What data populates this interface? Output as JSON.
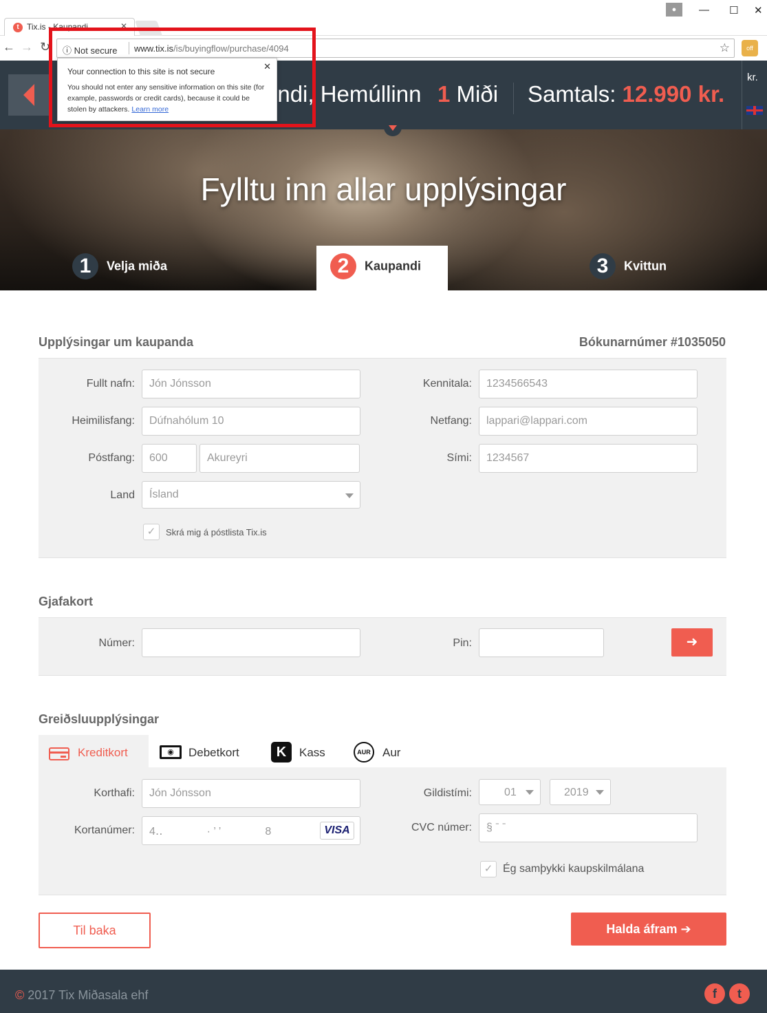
{
  "browser": {
    "tab_title": "Tix.is - Kaupandi",
    "favicon_letter": "t",
    "security_label": "Not secure",
    "url_host": "www.tix.is",
    "url_path": "/is/buyingflow/purchase/4094",
    "profile_icon": "person-icon",
    "extension_badge": "off"
  },
  "security_popup": {
    "title": "Your connection to this site is not secure",
    "body": "You should not enter any sensitive information on this site (for example, passwords or credit cards), because it could be stolen by attackers.",
    "link": "Learn more"
  },
  "header": {
    "event_title": "endi, Hemúllinn",
    "ticket_count": "1",
    "ticket_label": "Miði",
    "total_label": "Samtals:",
    "total_amount": "12.990 kr.",
    "currency": "kr."
  },
  "hero": {
    "title": "Fylltu inn allar upplýsingar",
    "steps": [
      {
        "num": "1",
        "label": "Velja miða"
      },
      {
        "num": "2",
        "label": "Kaupandi"
      },
      {
        "num": "3",
        "label": "Kvittun"
      }
    ]
  },
  "buyer": {
    "section_title": "Upplýsingar um kaupanda",
    "booking_number": "Bókunarnúmer #1035050",
    "name_label": "Fullt nafn:",
    "name_placeholder": "Jón Jónsson",
    "address_label": "Heimilisfang:",
    "address_placeholder": "Dúfnahólum 10",
    "postal_label": "Póstfang:",
    "postal_code_placeholder": "600",
    "city_placeholder": "Akureyri",
    "country_label": "Land",
    "country_value": "Ísland",
    "kennitala_label": "Kennitala:",
    "kennitala_placeholder": "1234566543",
    "email_label": "Netfang:",
    "email_placeholder": "lappari@lappari.com",
    "phone_label": "Sími:",
    "phone_placeholder": "1234567",
    "mailing_list_label": "Skrá mig á póstlista Tix.is",
    "mailing_list_checked": true
  },
  "giftcard": {
    "section_title": "Gjafakort",
    "number_label": "Númer:",
    "pin_label": "Pin:",
    "submit_icon": "arrow-right-icon"
  },
  "payment": {
    "section_title": "Greiðsluupplýsingar",
    "tabs": [
      "Kreditkort",
      "Debetkort",
      "Kass",
      "Aur"
    ],
    "debet_glyph": "◉",
    "kass_glyph": "K",
    "aur_glyph": "AUR",
    "cardholder_label": "Korthafi:",
    "cardholder_placeholder": "Jón Jónsson",
    "card_number_label": "Kortanúmer:",
    "card_number_value": "4‥    · ’ ’    8",
    "card_brand": "VISA",
    "expiry_label": "Gildistími:",
    "expiry_month": "01",
    "expiry_year": "2019",
    "cvc_label": "CVC númer:",
    "cvc_value": "§ ˉ ˉ",
    "terms_label": "Ég samþykki kaupskilmálana",
    "terms_checked": true
  },
  "actions": {
    "back_label": "Til baka",
    "next_label": "Halda áfram ➔"
  },
  "footer": {
    "copyright_symbol": "©",
    "copyright_text": "2017 Tix Miðasala ehf",
    "social": [
      "f",
      "t"
    ]
  },
  "colors": {
    "accent": "#f05d50",
    "header_bg": "#303c46",
    "panel_bg": "#f1f1f1"
  }
}
